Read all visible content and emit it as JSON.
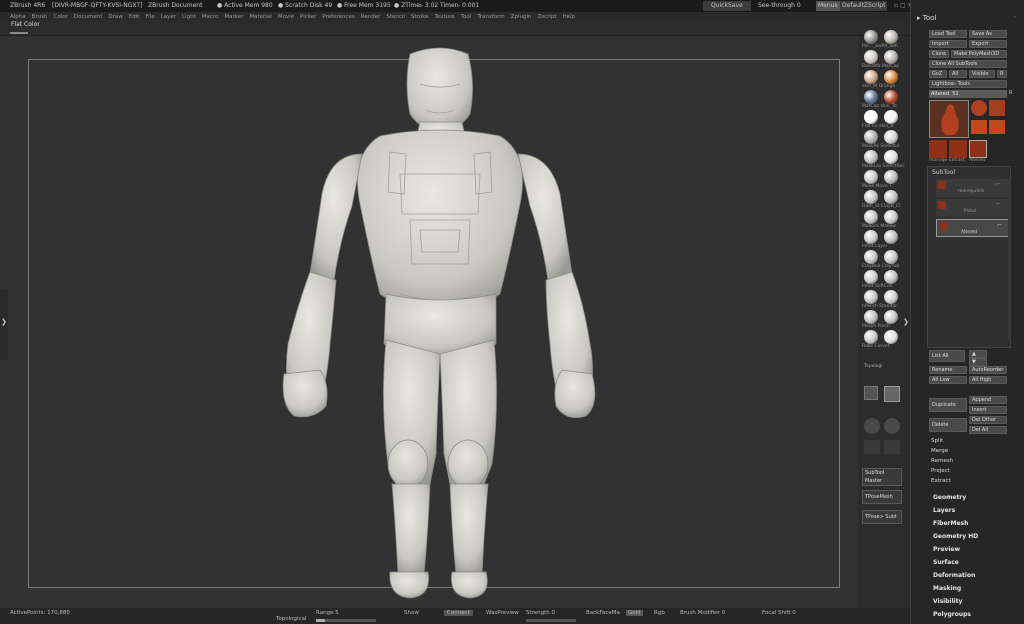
{
  "titlebar": {
    "app": "ZBrush 4R6",
    "serial": "[DIVR-MBGF-QFTY-KVSI-NGXT]",
    "document": "ZBrush Document",
    "active_mem": "● Active Mem 980",
    "scratch_disk": "● Scratch Disk 49",
    "free_mem": "● Free Mem 3195",
    "ztime": "● ZTime▹ 3.02",
    "timer": "Timer▹ 0.001",
    "quicksave": "QuickSave",
    "see_through": "See-through",
    "see_through_value": "0",
    "menus": "Menus",
    "default_zscript": "DefaultZScript"
  },
  "menubar": [
    "Alpha",
    "Brush",
    "Color",
    "Document",
    "Draw",
    "Edit",
    "File",
    "Layer",
    "Light",
    "Macro",
    "Marker",
    "Material",
    "Movie",
    "Picker",
    "Preferences",
    "Render",
    "Stencil",
    "Stroke",
    "Texture",
    "Tool",
    "Transform",
    "Zplugin",
    "Zscript",
    "Help"
  ],
  "subbar": {
    "flat_color": "Flat Color"
  },
  "materials": [
    {
      "label": "Pol..._waPR_xeR",
      "c1": "#8a8a86",
      "c2": "#b5b0a8"
    },
    {
      "label": "BasicMa MatCap",
      "c1": "#c9c4bb",
      "c2": "#b0aca6"
    },
    {
      "label": "skin_M Orange",
      "c1": "#c8a080",
      "c2": "#d88030"
    },
    {
      "label": "MatCap skin_Te",
      "c1": "#5a7090",
      "c2": "#b04020"
    },
    {
      "label": "Flat Co skin_B",
      "c1": "#ffffff",
      "c2": "#f0f0f0"
    },
    {
      "label": "MaskPe SelectLa",
      "c1": "#aaaaaa",
      "c2": "#cfcfcf"
    },
    {
      "label": "MaskLas SelectRec",
      "c1": "#bbbbbb",
      "c2": "#dddddd"
    },
    {
      "label": "Move Move T",
      "c1": "#c4c4c4",
      "c2": "#b8b8b8"
    },
    {
      "label": "Dam_St ClayB_Cl",
      "c1": "#c0c0c0",
      "c2": "#bcbcbc"
    },
    {
      "label": "Mallock Mallow",
      "c1": "#bfbfbf",
      "c2": "#c8c8c8"
    },
    {
      "label": "Inflat Layer",
      "c1": "#c6c6c6",
      "c2": "#b9b9b9"
    },
    {
      "label": "ClayBuil ClayTub",
      "c1": "#c0c0c0",
      "c2": "#c4c4c4"
    },
    {
      "label": "Inflat SoftCon",
      "c1": "#c8c8c8",
      "c2": "#bdbdbd"
    },
    {
      "label": "hPolish Standar",
      "c1": "#c2c2c2",
      "c2": "#cacaca"
    },
    {
      "label": "Morph Pinch",
      "c1": "#bcbcbc",
      "c2": "#c0c0c0"
    },
    {
      "label": "Rake Curvet",
      "c1": "#c4c4c4",
      "c2": "#dcdcdc"
    }
  ],
  "shelf_bottom": {
    "topological": "Topologi",
    "zsub": "SubTool Master",
    "tposemesh": "TPoseMesh",
    "tposesub": "TPose> Subt"
  },
  "tool_panel": {
    "title": "Tool",
    "load_tool": "Load Tool",
    "save_as": "Save As",
    "import": "Import",
    "export": "Export",
    "clone": "Clone",
    "make_polymesh": "Make PolyMesh3D",
    "goz": "GoZ",
    "all": "All",
    "visible": "Visible",
    "lightbox_tools": "Lightbox▹ Tools",
    "altered": "Altered. 51",
    "thumbs": [
      "altered",
      "Cylinder",
      "PolyMes",
      "SimpleB",
      "FuncSpt",
      "manage",
      "Extract",
      "altered"
    ],
    "subtool_title": "SubTool",
    "subtools": [
      "manepulick",
      "Pistol",
      "Altered"
    ],
    "list_all": "List All",
    "rename": "Rename",
    "autoreorder": "AutoReorder",
    "all_low": "All Low",
    "all_high": "All High",
    "duplicate": "Duplicate",
    "append": "Append",
    "insert": "Insert",
    "delete": "Delete",
    "del_other": "Del Other",
    "del_all": "Del All",
    "split": "Split",
    "merge": "Merge",
    "remesh": "Remesh",
    "project": "Project",
    "extract": "Extract",
    "sections": [
      "Geometry",
      "Layers",
      "FiberMesh",
      "Geometry HD",
      "Preview",
      "Surface",
      "Deformation",
      "Masking",
      "Visibility",
      "Polygroups"
    ]
  },
  "statusbar": {
    "active_points": "ActivePoints: 170,880",
    "topological": "Topological",
    "range": "Range 5",
    "show": "Show",
    "connect": "Connect",
    "was_preview": "WasPreview",
    "strength": "Strength 0",
    "backface": "BackFaceMa",
    "gold": "Gold",
    "rgb": "Rgb",
    "brush_modifier": "Brush Modifier 0",
    "focal_shift": "Focal Shift 0"
  },
  "colors": {
    "accent": "#d88030",
    "panel": "#262626",
    "canvas": "#323232",
    "model": "#d8d8d0"
  }
}
